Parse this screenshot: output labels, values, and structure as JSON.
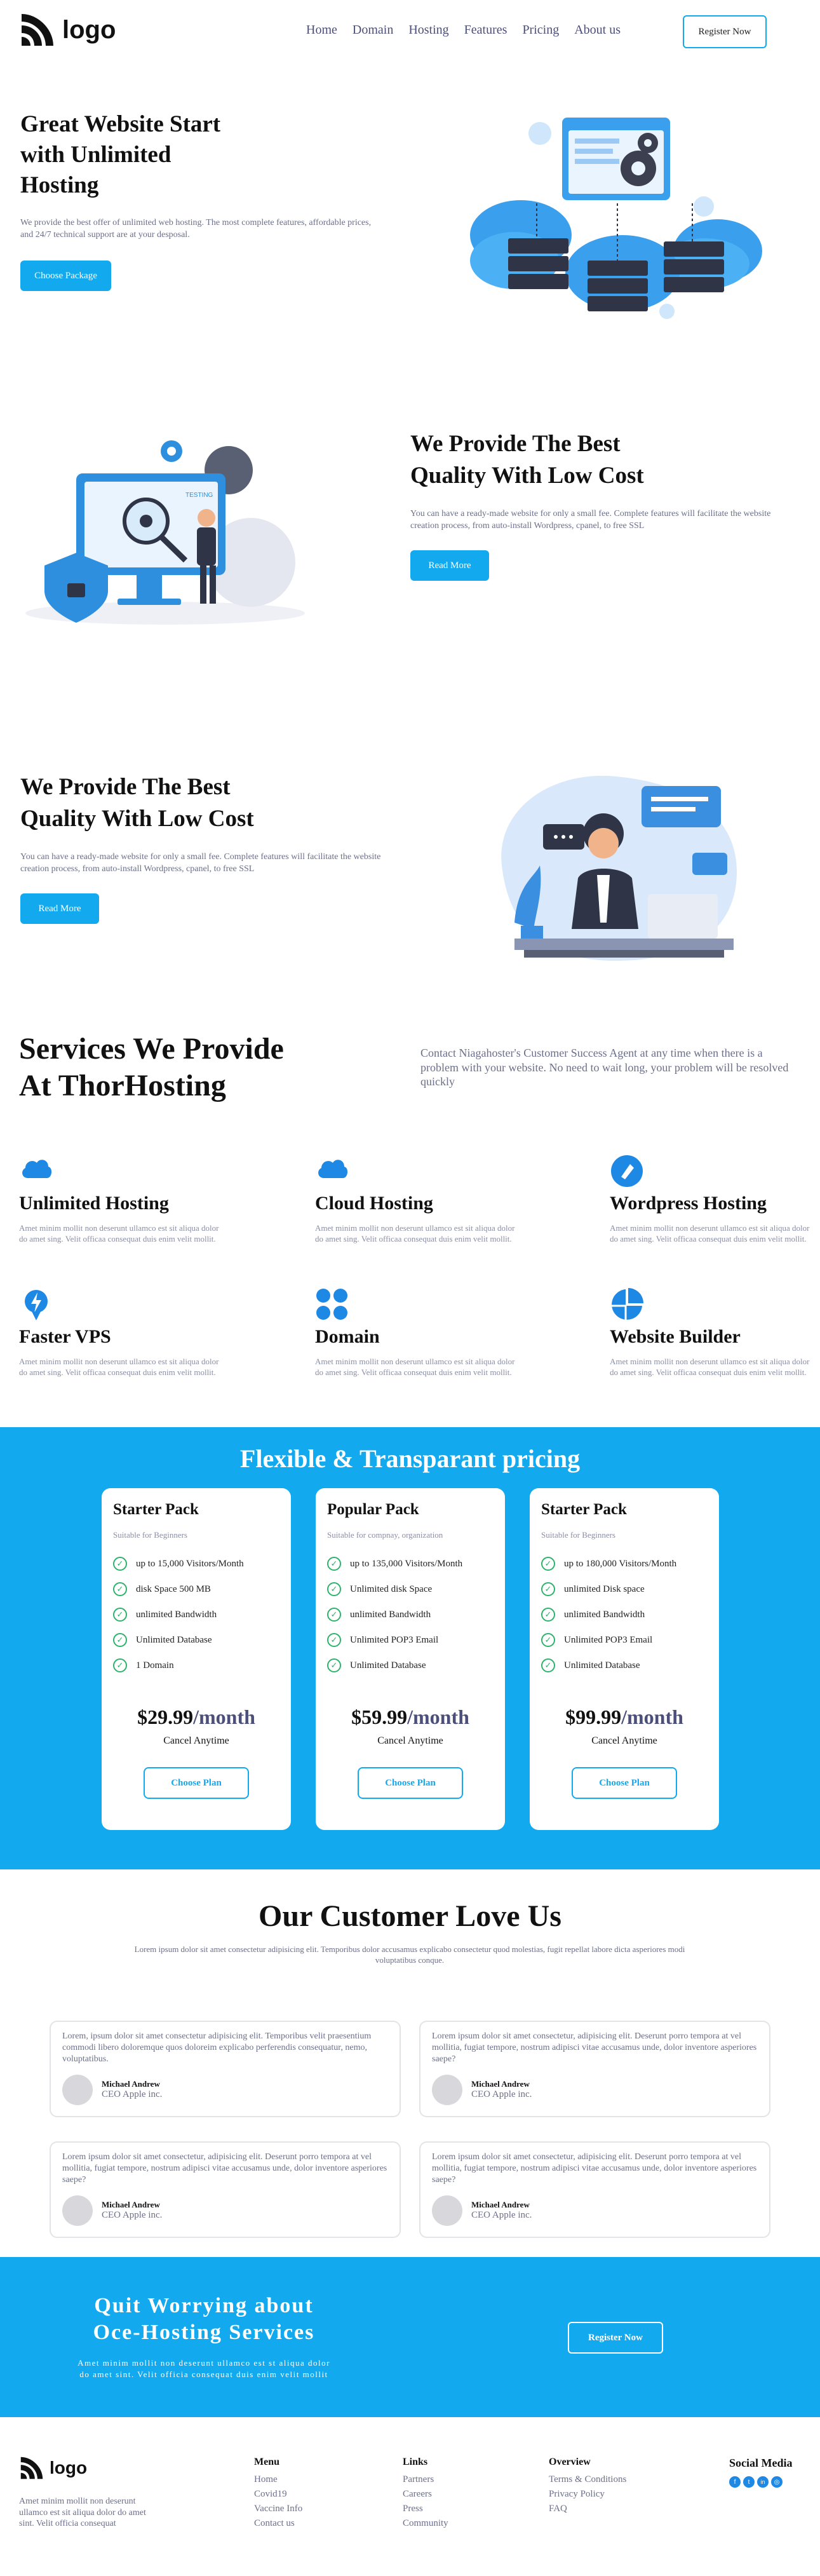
{
  "header": {
    "logo_text": "logo",
    "nav": [
      "Home",
      "Domain",
      "Hosting",
      "Features",
      "Pricing",
      "About us"
    ],
    "register_label": "Register Now"
  },
  "hero": {
    "title_line1": "Great Website Start",
    "title_line2": "with Unlimited",
    "title_line3": "Hosting",
    "text": "We provide the best offer of unlimited web hosting. The most complete features, affordable prices, and 24/7 technical support are at your desposal.",
    "button": "Choose Package"
  },
  "section2": {
    "title_line1": "We Provide The Best",
    "title_line2": "Quality With Low Cost",
    "text": "You can have a ready-made website for only a small fee. Complete features will facilitate the website creation process, from auto-install Wordpress, cpanel, to free SSL",
    "button": "Read More",
    "illustration_label": "TESTING"
  },
  "section3": {
    "title_line1": "We Provide The Best",
    "title_line2": "Quality With Low Cost",
    "text": "You can have a ready-made website for only a small fee. Complete features will facilitate the website creation process, from auto-install Wordpress, cpanel, to free SSL",
    "button": "Read More"
  },
  "services": {
    "title_line1": "Services We Provide",
    "title_line2": "At ThorHosting",
    "intro": "Contact Niagahoster's Customer Success Agent at any time when there is a problem with your website. No need to wait long, your problem will be resolved quickly",
    "items": [
      {
        "icon": "cloud-icon",
        "title": "Unlimited Hosting",
        "text": "Amet minim mollit non deserunt ullamco est sit aliqua dolor do amet sing. Velit officaa consequat duis enim velit mollit."
      },
      {
        "icon": "cloud-icon",
        "title": "Cloud Hosting",
        "text": "Amet minim mollit non deserunt ullamco est sit aliqua dolor do amet sing. Velit officaa consequat duis enim velit mollit."
      },
      {
        "icon": "wordpress-icon",
        "title": "Wordpress Hosting",
        "text": "Amet minim mollit non deserunt ullamco est sit aliqua dolor do amet sing. Velit officaa consequat duis enim velit mollit."
      },
      {
        "icon": "lightning-icon",
        "title": "Faster VPS",
        "text": "Amet minim mollit non deserunt ullamco est sit aliqua dolor do amet sing. Velit officaa consequat duis enim velit mollit."
      },
      {
        "icon": "grid-icon",
        "title": "Domain",
        "text": "Amet minim mollit non deserunt ullamco est sit aliqua dolor do amet sing. Velit officaa consequat duis enim velit mollit."
      },
      {
        "icon": "pie-icon",
        "title": "Website Builder",
        "text": "Amet minim mollit non deserunt ullamco est sit aliqua dolor do amet sing. Velit officaa consequat duis enim velit mollit."
      }
    ]
  },
  "pricing": {
    "title": "Flexible & Transparant pricing",
    "plans": [
      {
        "name": "Starter Pack",
        "sub": "Suitable for Beginners",
        "features": [
          "up to 15,000 Visitors/Month",
          "disk Space 500 MB",
          "unlimited Bandwidth",
          "Unlimited Database",
          "1 Domain"
        ],
        "price": "$29.99",
        "per": "/month",
        "cancel": "Cancel Anytime",
        "button": "Choose Plan"
      },
      {
        "name": "Popular Pack",
        "sub": "Suitable for compnay, organization",
        "features": [
          "up to 135,000 Visitors/Month",
          "Unlimited disk Space",
          "unlimited Bandwidth",
          "Unlimited POP3 Email",
          "Unlimited Database"
        ],
        "price": "$59.99",
        "per": "/month",
        "cancel": "Cancel Anytime",
        "button": "Choose Plan"
      },
      {
        "name": "Starter Pack",
        "sub": "Suitable for Beginners",
        "features": [
          "up to 180,000 Visitors/Month",
          "unlimited Disk space",
          "unlimited Bandwidth",
          "Unlimited POP3 Email",
          "Unlimited Database"
        ],
        "price": "$99.99",
        "per": "/month",
        "cancel": "Cancel Anytime",
        "button": "Choose Plan"
      }
    ]
  },
  "testimonials": {
    "title": "Our Customer Love Us",
    "intro": "Lorem ipsum dolor sit amet consectetur adipisicing elit. Temporibus dolor accusamus explicabo consectetur quod molestias, fugit repellat labore dicta asperiores modi voluptatibus conque.",
    "items": [
      {
        "text": "Lorem, ipsum dolor sit amet consectetur adipisicing elit. Temporibus velit praesentium commodi libero doloremque quos doloreim explicabo perferendis consequatur, nemo, voluptatibus.",
        "name": "Michael Andrew",
        "role": "CEO Apple inc."
      },
      {
        "text": "Lorem ipsum dolor sit amet consectetur, adipisicing elit. Deserunt porro tempora at vel mollitia, fugiat tempore, nostrum adipisci vitae accusamus unde, dolor inventore asperiores saepe?",
        "name": "Michael Andrew",
        "role": "CEO Apple inc."
      },
      {
        "text": "Lorem ipsum dolor sit amet consectetur, adipisicing elit. Deserunt porro tempora at vel mollitia, fugiat tempore, nostrum adipisci vitae accusamus unde, dolor inventore asperiores saepe?",
        "name": "Michael Andrew",
        "role": "CEO Apple inc."
      },
      {
        "text": "Lorem ipsum dolor sit amet consectetur, adipisicing elit. Deserunt porro tempora at vel mollitia, fugiat tempore, nostrum adipisci vitae accusamus unde, dolor inventore asperiores saepe?",
        "name": "Michael Andrew",
        "role": "CEO Apple inc."
      }
    ]
  },
  "cta": {
    "title_line1": "Quit Worrying about",
    "title_line2": "Oce-Hosting Services",
    "text_line1": "Amet minim mollit non deserunt ullamco est st aliqua dolor",
    "text_line2": "do amet sint. Velit officia consequat duis enim velit mollit",
    "button": "Register Now"
  },
  "footer": {
    "logo_text": "logo",
    "about": "Amet minim mollit non deserunt ullamco est sit aliqua dolor do amet sint. Velit officia consequat",
    "menu": {
      "title": "Menu",
      "items": [
        "Home",
        "Covid19",
        "Vaccine Info",
        "Contact us"
      ]
    },
    "links": {
      "title": "Links",
      "items": [
        "Partners",
        "Careers",
        "Press",
        "Community"
      ]
    },
    "overview": {
      "title": "Overview",
      "items": [
        "Terms & Conditions",
        "Privacy Policy",
        "FAQ"
      ]
    },
    "social": {
      "title": "Social Media",
      "icons": [
        "facebook-icon",
        "twitter-icon",
        "linkedin-icon",
        "instagram-icon"
      ]
    }
  },
  "colors": {
    "accent": "#12a9ee",
    "dark": "#111111",
    "muted": "#6b6f8a"
  }
}
